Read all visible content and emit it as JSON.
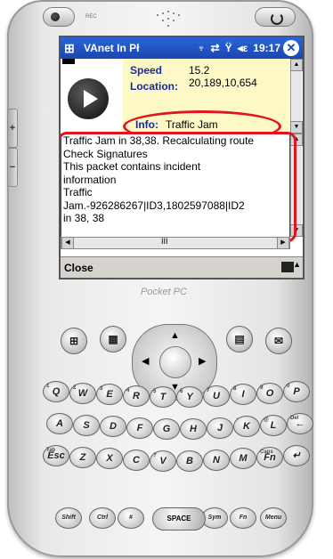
{
  "device": {
    "top_label": "REC",
    "side_plus": "+",
    "side_minus": "−",
    "brand": "Pocket PC"
  },
  "titlebar": {
    "start_icon": "windows-flag-icon",
    "app_title": "VAnet In Pł",
    "time": "19:17",
    "close": "✕",
    "icons": [
      "gps-icon",
      "connectivity-icon",
      "signal-icon",
      "speaker-icon"
    ]
  },
  "info": {
    "speed_label": "Speed",
    "speed_value": "15.2",
    "location_label": "Location:",
    "location_value": "20,189,10,654",
    "info_label": "Info:",
    "info_value": "Traffic Jam"
  },
  "log": {
    "lines": [
      "Traffic Jam in 38,38. Recalculating route",
      "Check Signatures",
      "This packet contains incident",
      "information",
      "Traffic",
      "Jam.-926286267|ID3,1802597088|ID2",
      "in 38, 38"
    ]
  },
  "scroll": {
    "h_thumb": "III"
  },
  "menubar": {
    "left": "Close"
  },
  "keys": {
    "row1": [
      "Q",
      "W",
      "E",
      "R",
      "T",
      "Y",
      "U",
      "I",
      "O",
      "P"
    ],
    "row1_sub": [
      "1",
      "2",
      "3",
      "4",
      "5",
      "6",
      "7",
      "8",
      "9",
      "0"
    ],
    "row2": [
      "A",
      "S",
      "D",
      "F",
      "G",
      "H",
      "J",
      "K",
      "L",
      "←"
    ],
    "row2_sub": [
      "",
      "",
      "",
      "",
      "",
      "",
      "",
      "'",
      "@",
      "Del"
    ],
    "row3": [
      "Esc",
      "Z",
      "X",
      "C",
      "V",
      "B",
      "N",
      "M",
      "Fn",
      "↵"
    ],
    "row3_sub": [
      "Tab",
      "",
      "",
      "",
      "?",
      "",
      "",
      "",
      "Caps",
      ""
    ],
    "row4": [
      "Shift",
      "Ctrl",
      "#",
      "SPACE",
      "Sym",
      "Fn",
      "Menu"
    ],
    "space_label": "SPACE"
  }
}
